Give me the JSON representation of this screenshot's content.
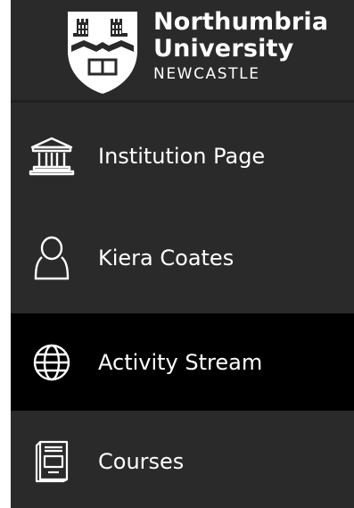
{
  "logo": {
    "line1": "Northumbria",
    "line2": "University",
    "line3": "NEWCASTLE",
    "icon": "crest-icon"
  },
  "nav": {
    "items": [
      {
        "label": "Institution Page",
        "icon": "institution-icon",
        "active": false
      },
      {
        "label": "Kiera Coates",
        "icon": "user-icon",
        "active": false
      },
      {
        "label": "Activity Stream",
        "icon": "globe-icon",
        "active": true
      },
      {
        "label": "Courses",
        "icon": "courses-icon",
        "active": false
      }
    ]
  },
  "colors": {
    "background": "#2a2a2a",
    "active_background": "#000000",
    "text": "#ffffff"
  }
}
